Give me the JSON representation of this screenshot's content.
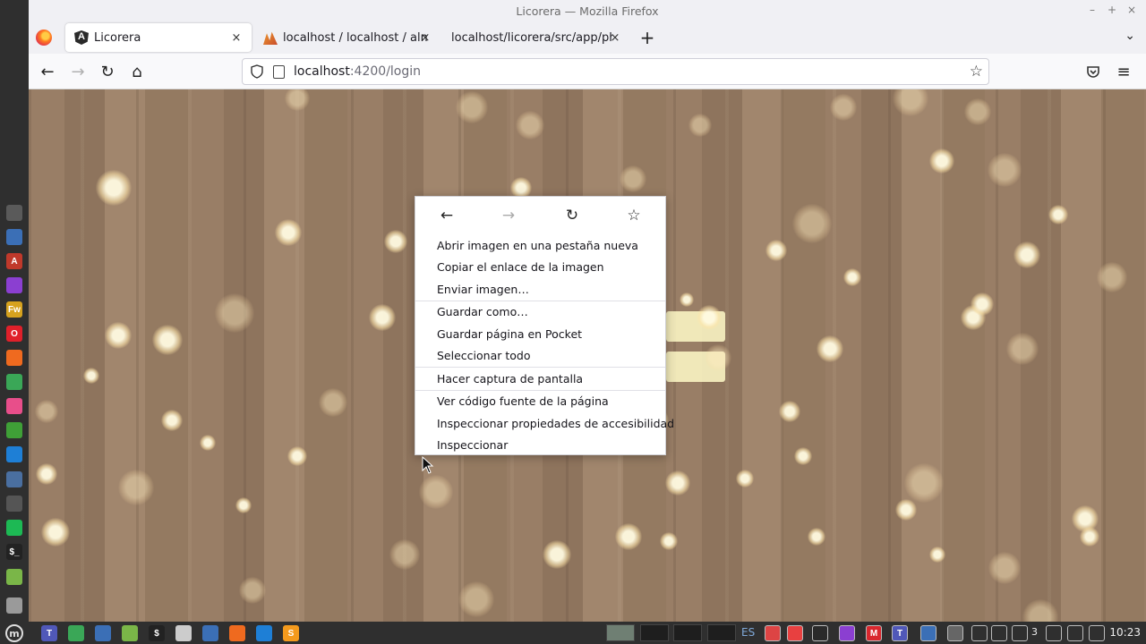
{
  "window": {
    "title": "Licorera — Mozilla Firefox",
    "minimize": "–",
    "maximize": "+",
    "close": "×"
  },
  "tabs": [
    {
      "title": "Licorera",
      "icon": "angular-icon",
      "active": true
    },
    {
      "title": "localhost / localhost / almac",
      "icon": "phpmyadmin-icon",
      "active": false
    },
    {
      "title": "localhost/licorera/src/app/php/",
      "icon": "",
      "active": false
    }
  ],
  "tab_close": "×",
  "new_tab": "+",
  "tab_list": "⌄",
  "nav": {
    "back": "←",
    "forward": "→",
    "reload": "↻",
    "home": "⌂",
    "url_host": "localhost",
    "url_path": ":4200/login",
    "bookmark": "☆",
    "pocket": "pocket-icon",
    "menu": "≡"
  },
  "context_menu": {
    "nav": {
      "back": "←",
      "forward": "→",
      "reload": "↻",
      "bookmark": "☆"
    },
    "groups": [
      [
        "Abrir imagen en una pestaña nueva",
        "Copiar el enlace de la imagen",
        "Enviar imagen…"
      ],
      [
        "Guardar como…",
        "Guardar página en Pocket",
        "Seleccionar todo"
      ],
      [
        "Hacer captura de pantalla"
      ],
      [
        "Ver código fuente de la página",
        "Inspeccionar propiedades de accesibilidad",
        "Inspeccionar"
      ]
    ]
  },
  "dock": {
    "icons": [
      {
        "name": "calculator-icon",
        "color": "#5a5a5a",
        "label": ""
      },
      {
        "name": "mail-icon",
        "color": "#3b6fb6",
        "label": ""
      },
      {
        "name": "pdf-icon",
        "color": "#c0392b",
        "label": "A"
      },
      {
        "name": "firefox-dev-icon",
        "color": "#8b3fd1",
        "label": ""
      },
      {
        "name": "fireworks-icon",
        "color": "#d6a21e",
        "label": "Fw"
      },
      {
        "name": "opera-icon",
        "color": "#e0202a",
        "label": "O"
      },
      {
        "name": "firefox-icon",
        "color": "#ef6a1f",
        "label": ""
      },
      {
        "name": "chrome-icon",
        "color": "#3aa757",
        "label": ""
      },
      {
        "name": "app-icon",
        "color": "#e84e8a",
        "label": ""
      },
      {
        "name": "mongodb-icon",
        "color": "#3fa037",
        "label": ""
      },
      {
        "name": "vscode-icon",
        "color": "#1e7fd6",
        "label": ""
      },
      {
        "name": "settings-icon",
        "color": "#4a6fa0",
        "label": ""
      },
      {
        "name": "screen-icon",
        "color": "#555555",
        "label": ""
      },
      {
        "name": "spotify-icon",
        "color": "#1db954",
        "label": ""
      },
      {
        "name": "terminal-icon",
        "color": "#222222",
        "label": "$_"
      },
      {
        "name": "folder-icon",
        "color": "#7ab648",
        "label": ""
      },
      {
        "name": "trash-icon",
        "color": "#9a9a9a",
        "label": ""
      }
    ]
  },
  "panel": {
    "menu_icon": "mint-menu-icon",
    "apps": [
      {
        "name": "teams-icon",
        "color": "#5058b8",
        "label": "T"
      },
      {
        "name": "update-icon",
        "color": "#3aa757",
        "label": ""
      },
      {
        "name": "mail-icon",
        "color": "#3b6fb6",
        "label": ""
      },
      {
        "name": "folder-icon",
        "color": "#7ab648",
        "label": ""
      },
      {
        "name": "terminal-icon",
        "color": "#222222",
        "label": "$"
      },
      {
        "name": "settings-icon",
        "color": "#cccccc",
        "label": ""
      },
      {
        "name": "screenshot-icon",
        "color": "#3b6fb6",
        "label": ""
      },
      {
        "name": "firefox-icon",
        "color": "#ef6a1f",
        "label": ""
      },
      {
        "name": "vscode-icon",
        "color": "#1e7fd6",
        "label": ""
      },
      {
        "name": "sublime-icon",
        "color": "#f49a1d",
        "label": "S"
      }
    ],
    "lang": "ES",
    "tray": [
      {
        "name": "clock-icon",
        "color": "#dd4444",
        "label": ""
      },
      {
        "name": "anydesk-icon",
        "color": "#e84040",
        "label": ""
      },
      {
        "name": "dropbox-icon",
        "color": "#2a2a2a",
        "label": ""
      },
      {
        "name": "firefox-dev-icon",
        "color": "#8b3fd1",
        "label": ""
      },
      {
        "name": "mega-icon",
        "color": "#d9272e",
        "label": "M"
      },
      {
        "name": "teams-icon",
        "color": "#5058b8",
        "label": "T"
      },
      {
        "name": "screenshot-icon",
        "color": "#3b6fb6",
        "label": ""
      },
      {
        "name": "drive-icon",
        "color": "#666666",
        "label": ""
      },
      {
        "name": "bluetooth-icon",
        "color": "#2f2f2f",
        "label": ""
      },
      {
        "name": "shield-icon",
        "color": "#2f2f2f",
        "label": ""
      },
      {
        "name": "network-badge-icon",
        "color": "#2f2f2f",
        "label": ""
      }
    ],
    "notif_count": "3",
    "tray2": [
      {
        "name": "wifi-icon",
        "color": "#2f2f2f",
        "label": ""
      },
      {
        "name": "volume-icon",
        "color": "#2f2f2f",
        "label": ""
      },
      {
        "name": "clipboard-icon",
        "color": "#2f2f2f",
        "label": ""
      }
    ],
    "time": "10:23"
  }
}
